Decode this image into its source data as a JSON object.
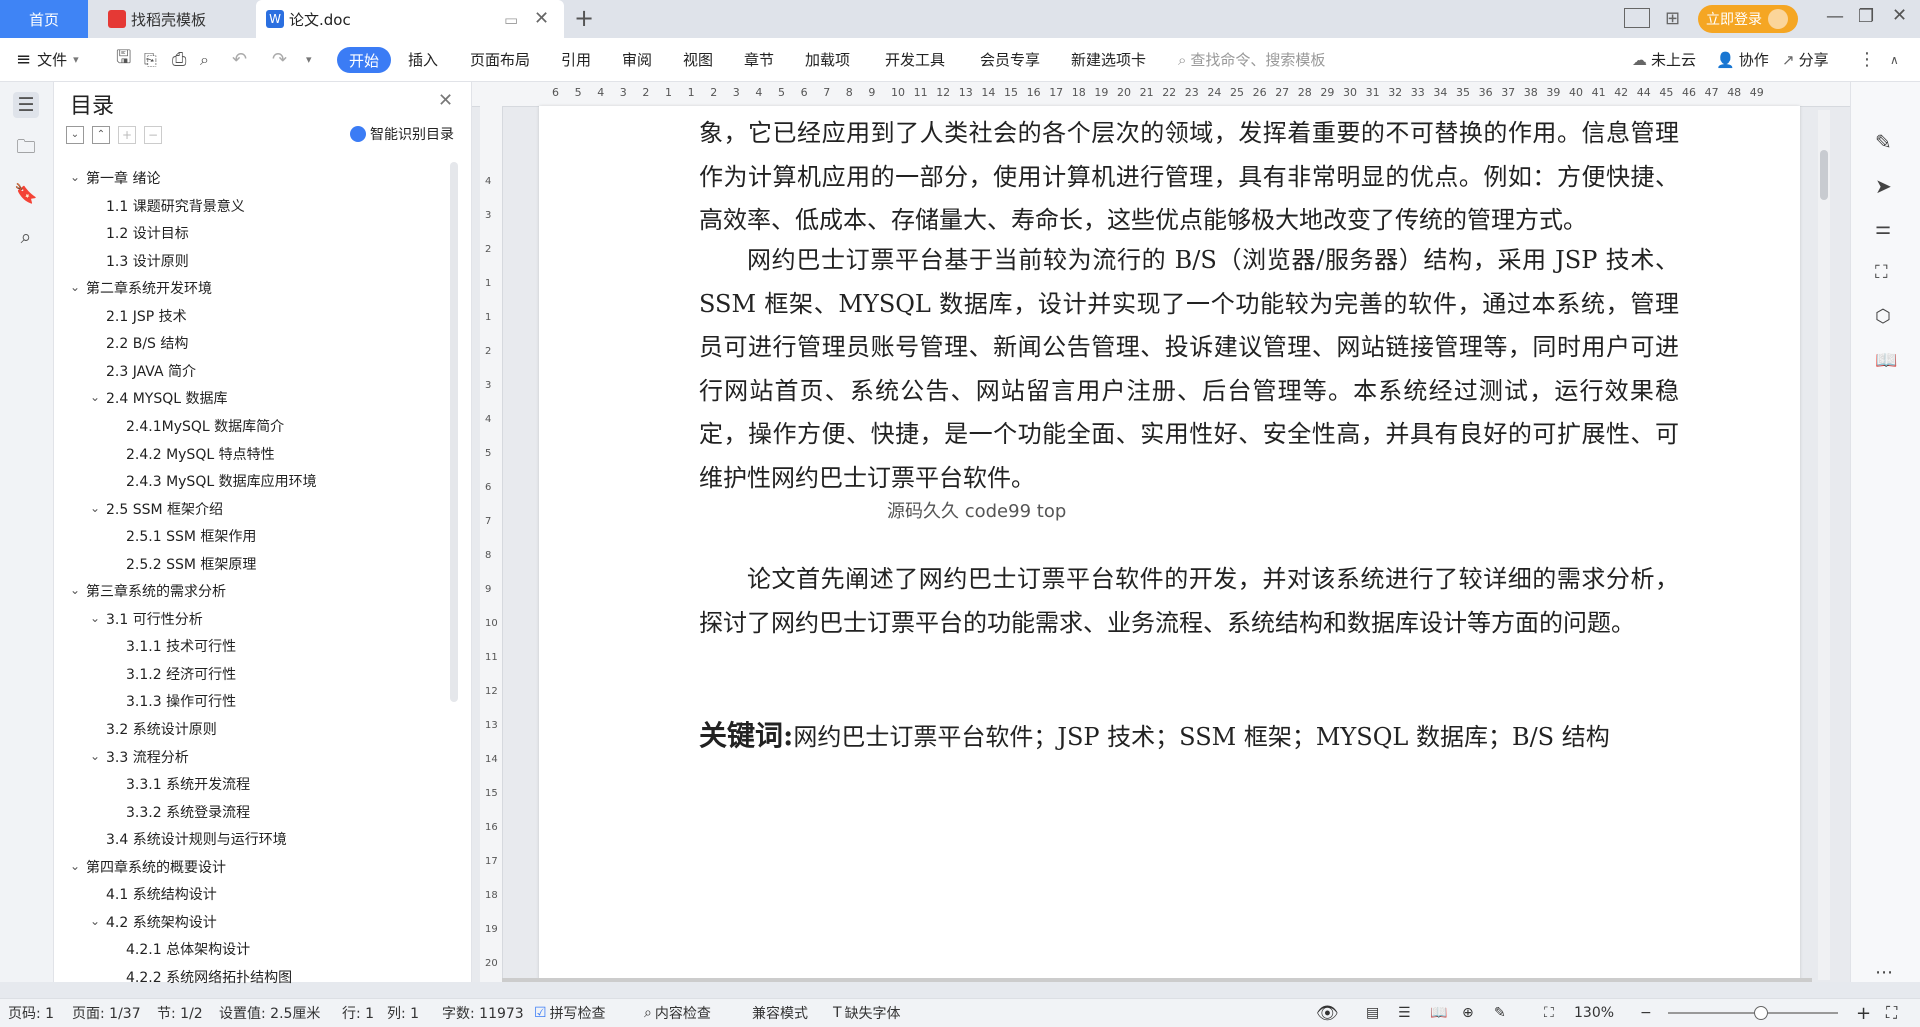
{
  "tabs": {
    "home": "首页",
    "templates": "找稻壳模板",
    "doc": "论文.doc",
    "login": "立即登录"
  },
  "ribbon": {
    "file": "文件",
    "menus": [
      "开始",
      "插入",
      "页面布局",
      "引用",
      "审阅",
      "视图",
      "章节",
      "加载项",
      "开发工具",
      "会员专享",
      "新建选项卡"
    ],
    "search_placeholder": "查找命令、搜索模板",
    "cloud": "未上云",
    "collab": "协作",
    "share": "分享"
  },
  "toc": {
    "title": "目录",
    "smart": "智能识别目录",
    "items": [
      "第一章 绪论",
      "1.1 课题研究背景意义",
      "1.2 设计目标",
      "1.3  设计原则",
      "第二章系统开发环境",
      "2.1 JSP 技术",
      "2.2 B/S 结构",
      "2.3 JAVA 简介",
      "2.4 MYSQL 数据库",
      "2.4.1MySQL 数据库简介",
      "2.4.2 MySQL 特点特性",
      "2.4.3 MySQL 数据库应用环境",
      "2.5 SSM 框架介绍",
      "2.5.1 SSM 框架作用",
      "2.5.2 SSM 框架原理",
      "第三章系统的需求分析",
      "3.1 可行性分析",
      "3.1.1  技术可行性",
      "3.1.2 经济可行性",
      "3.1.3 操作可行性",
      "3.2 系统设计原则",
      "3.3 流程分析",
      "3.3.1  系统开发流程",
      "3.3.2  系统登录流程",
      "3.4 系统设计规则与运行环境",
      "第四章系统的概要设计",
      "4.1  系统结构设计",
      "4.2  系统架构设计",
      "4.2.1 总体架构设计",
      "4.2.2 系统网络拓扑结构图"
    ]
  },
  "ruler": {
    "h_ticks": [
      "6",
      "5",
      "4",
      "3",
      "2",
      "1",
      "1",
      "2",
      "3",
      "4",
      "5",
      "6",
      "7",
      "8",
      "9",
      "10",
      "11",
      "12",
      "13",
      "14",
      "15",
      "16",
      "17",
      "18",
      "19",
      "20",
      "21",
      "22",
      "23",
      "24",
      "25",
      "26",
      "27",
      "28",
      "29",
      "30",
      "31",
      "32",
      "33",
      "34",
      "35",
      "36",
      "37",
      "38",
      "39",
      "40",
      "41",
      "42",
      "44",
      "45",
      "46",
      "47",
      "48",
      "49"
    ],
    "v_ticks": [
      "4",
      "3",
      "2",
      "1",
      "1",
      "2",
      "3",
      "4",
      "5",
      "6",
      "7",
      "8",
      "9",
      "10",
      "11",
      "12",
      "13",
      "14",
      "15",
      "16",
      "17",
      "18",
      "19",
      "20"
    ]
  },
  "document": {
    "para1": "象，它已经应用到了人类社会的各个层次的领域，发挥着重要的不可替换的作用。信息管理作为计算机应用的一部分，使用计算机进行管理，具有非常明显的优点。例如：方便快捷、高效率、低成本、存储量大、寿命长，这些优点能够极大地改变了传统的管理方式。",
    "para2": "网约巴士订票平台基于当前较为流行的 B/S（浏览器/服务器）结构，采用 JSP 技术、SSM 框架、MYSQL 数据库，设计并实现了一个功能较为完善的软件，通过本系统，管理员可进行管理员账号管理、新闻公告管理、投诉建议管理、网站链接管理等，同时用户可进行网站首页、系统公告、网站留言用户注册、后台管理等。本系统经过测试，运行效果稳定，操作方便、快捷，是一个功能全面、实用性好、安全性高，并具有良好的可扩展性、可维护性网约巴士订票平台软件。",
    "para3": "论文首先阐述了网约巴士订票平台软件的开发，并对该系统进行了较详细的需求分析，探讨了网约巴士订票平台的功能需求、业务流程、系统结构和数据库设计等方面的问题。",
    "watermark": "源码久久 code99 top",
    "keywords_label": "关键词:",
    "keywords": "网约巴士订票平台软件；JSP 技术；SSM 框架；MYSQL 数据库；B/S 结构"
  },
  "status": {
    "page_code": "页码: 1",
    "page": "页面: 1/37",
    "section": "节: 1/2",
    "setting": "设置值: 2.5厘米",
    "row": "行: 1",
    "col": "列: 1",
    "words": "字数: 11973",
    "spell": "拼写检查",
    "content_check": "内容检查",
    "compat": "兼容模式",
    "missing_font": "缺失字体",
    "zoom": "130%"
  },
  "colors": {
    "accent": "#3b7cf5",
    "login": "#f5a623"
  }
}
